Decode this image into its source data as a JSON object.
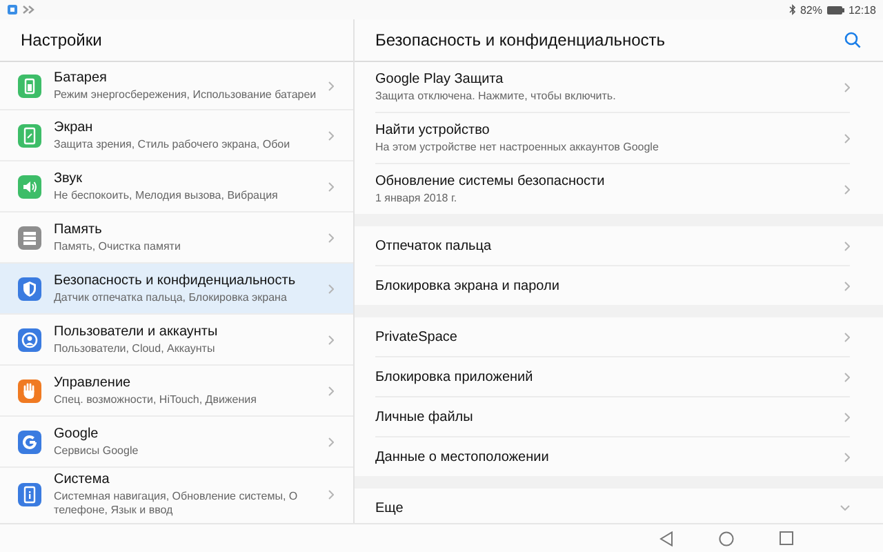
{
  "status_bar": {
    "battery": "82%",
    "time": "12:18"
  },
  "sidebar": {
    "title": "Настройки",
    "items": [
      {
        "title": "Батарея",
        "subtitle": "Режим энергосбережения, Использование батареи",
        "kind": "battery",
        "color": "#3dbd68",
        "selected": false
      },
      {
        "title": "Экран",
        "subtitle": "Защита зрения, Стиль рабочего экрана, Обои",
        "kind": "screen",
        "color": "#3dbd68",
        "selected": false
      },
      {
        "title": "Звук",
        "subtitle": "Не беспокоить, Мелодия вызова, Вибрация",
        "kind": "sound",
        "color": "#3dbd68",
        "selected": false
      },
      {
        "title": "Память",
        "subtitle": "Память, Очистка памяти",
        "kind": "storage",
        "color": "#8e8e8e",
        "selected": false
      },
      {
        "title": "Безопасность и конфиденциальность",
        "subtitle": "Датчик отпечатка пальца, Блокировка экрана",
        "kind": "shield",
        "color": "#3a7be0",
        "selected": true
      },
      {
        "title": "Пользователи и аккаунты",
        "subtitle": "Пользователи, Cloud, Аккаунты",
        "kind": "user",
        "color": "#3a7be0",
        "selected": false
      },
      {
        "title": "Управление",
        "subtitle": "Спец. возможности, HiTouch, Движения",
        "kind": "hand",
        "color": "#f07a22",
        "selected": false
      },
      {
        "title": "Google",
        "subtitle": "Сервисы Google",
        "kind": "google",
        "color": "#3a7be0",
        "selected": false
      },
      {
        "title": "Система",
        "subtitle": "Системная навигация, Обновление системы, О телефоне, Язык и ввод",
        "kind": "system",
        "color": "#3a7be0",
        "selected": false
      }
    ]
  },
  "detail": {
    "title": "Безопасность и конфиденциальность",
    "groups": [
      [
        {
          "title": "Google Play Защита",
          "subtitle": "Защита отключена. Нажмите, чтобы включить.",
          "kind": "link"
        },
        {
          "title": "Найти устройство",
          "subtitle": "На этом устройстве нет настроенных аккаунтов Google",
          "kind": "link"
        },
        {
          "title": "Обновление системы безопасности",
          "subtitle": "1 января 2018 г.",
          "kind": "link"
        }
      ],
      [
        {
          "title": "Отпечаток пальца",
          "kind": "link"
        },
        {
          "title": "Блокировка экрана и пароли",
          "kind": "link"
        }
      ],
      [
        {
          "title": "PrivateSpace",
          "kind": "link"
        },
        {
          "title": "Блокировка приложений",
          "kind": "link"
        },
        {
          "title": "Личные файлы",
          "kind": "link"
        },
        {
          "title": "Данные о местоположении",
          "kind": "link"
        }
      ],
      [
        {
          "title": "Еще",
          "kind": "expand"
        }
      ]
    ]
  }
}
